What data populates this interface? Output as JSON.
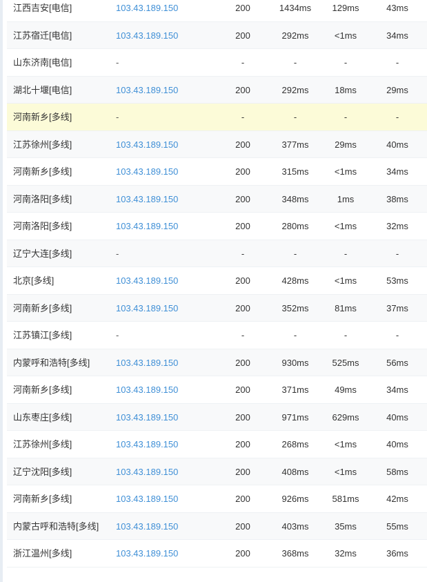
{
  "rows": [
    {
      "node": "江西吉安[电信]",
      "ip": "103.43.189.150",
      "status": "200",
      "total": "1434ms",
      "resolve": "129ms",
      "connect": "43ms",
      "style": "normal"
    },
    {
      "node": "江苏宿迁[电信]",
      "ip": "103.43.189.150",
      "status": "200",
      "total": "292ms",
      "resolve": "<1ms",
      "connect": "34ms",
      "style": "alt"
    },
    {
      "node": "山东济南[电信]",
      "ip": "-",
      "status": "-",
      "total": "-",
      "resolve": "-",
      "connect": "-",
      "style": "normal"
    },
    {
      "node": "湖北十堰[电信]",
      "ip": "103.43.189.150",
      "status": "200",
      "total": "292ms",
      "resolve": "18ms",
      "connect": "29ms",
      "style": "alt"
    },
    {
      "node": "河南新乡[多线]",
      "ip": "-",
      "status": "-",
      "total": "-",
      "resolve": "-",
      "connect": "-",
      "style": "highlight"
    },
    {
      "node": "江苏徐州[多线]",
      "ip": "103.43.189.150",
      "status": "200",
      "total": "377ms",
      "resolve": "29ms",
      "connect": "40ms",
      "style": "alt"
    },
    {
      "node": "河南新乡[多线]",
      "ip": "103.43.189.150",
      "status": "200",
      "total": "315ms",
      "resolve": "<1ms",
      "connect": "34ms",
      "style": "normal"
    },
    {
      "node": "河南洛阳[多线]",
      "ip": "103.43.189.150",
      "status": "200",
      "total": "348ms",
      "resolve": "1ms",
      "connect": "38ms",
      "style": "alt"
    },
    {
      "node": "河南洛阳[多线]",
      "ip": "103.43.189.150",
      "status": "200",
      "total": "280ms",
      "resolve": "<1ms",
      "connect": "32ms",
      "style": "normal"
    },
    {
      "node": "辽宁大连[多线]",
      "ip": "-",
      "status": "-",
      "total": "-",
      "resolve": "-",
      "connect": "-",
      "style": "alt"
    },
    {
      "node": "北京[多线]",
      "ip": "103.43.189.150",
      "status": "200",
      "total": "428ms",
      "resolve": "<1ms",
      "connect": "53ms",
      "style": "normal"
    },
    {
      "node": "河南新乡[多线]",
      "ip": "103.43.189.150",
      "status": "200",
      "total": "352ms",
      "resolve": "81ms",
      "connect": "37ms",
      "style": "alt"
    },
    {
      "node": "江苏镇江[多线]",
      "ip": "-",
      "status": "-",
      "total": "-",
      "resolve": "-",
      "connect": "-",
      "style": "normal"
    },
    {
      "node": "内蒙呼和浩特[多线]",
      "ip": "103.43.189.150",
      "status": "200",
      "total": "930ms",
      "resolve": "525ms",
      "connect": "56ms",
      "style": "alt"
    },
    {
      "node": "河南新乡[多线]",
      "ip": "103.43.189.150",
      "status": "200",
      "total": "371ms",
      "resolve": "49ms",
      "connect": "34ms",
      "style": "normal"
    },
    {
      "node": "山东枣庄[多线]",
      "ip": "103.43.189.150",
      "status": "200",
      "total": "971ms",
      "resolve": "629ms",
      "connect": "40ms",
      "style": "alt"
    },
    {
      "node": "江苏徐州[多线]",
      "ip": "103.43.189.150",
      "status": "200",
      "total": "268ms",
      "resolve": "<1ms",
      "connect": "40ms",
      "style": "normal"
    },
    {
      "node": "辽宁沈阳[多线]",
      "ip": "103.43.189.150",
      "status": "200",
      "total": "408ms",
      "resolve": "<1ms",
      "connect": "58ms",
      "style": "alt"
    },
    {
      "node": "河南新乡[多线]",
      "ip": "103.43.189.150",
      "status": "200",
      "total": "926ms",
      "resolve": "581ms",
      "connect": "42ms",
      "style": "normal"
    },
    {
      "node": "内蒙古呼和浩特[多线]",
      "ip": "103.43.189.150",
      "status": "200",
      "total": "403ms",
      "resolve": "35ms",
      "connect": "55ms",
      "style": "alt"
    },
    {
      "node": "浙江温州[多线]",
      "ip": "103.43.189.150",
      "status": "200",
      "total": "368ms",
      "resolve": "32ms",
      "connect": "36ms",
      "style": "normal"
    }
  ]
}
